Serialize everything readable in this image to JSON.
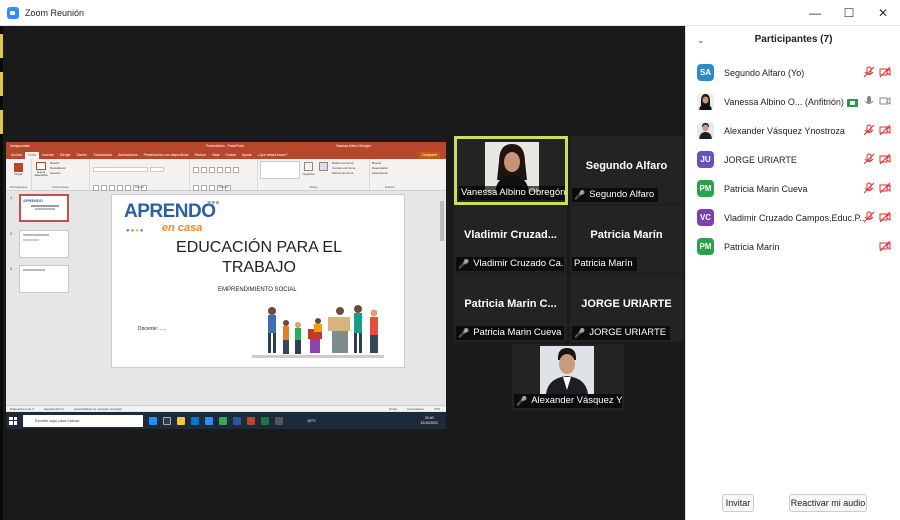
{
  "window": {
    "title": "Zoom Reunión",
    "minimize": "—",
    "maximize": "☐",
    "close": "✕"
  },
  "powerpoint": {
    "title_left": "Autoguardado",
    "title_center": "Presentación - PowerPoint",
    "title_user": "Vanessa Albino Obregón",
    "tabs": [
      "Archivo",
      "Inicio",
      "Insertar",
      "Dibujar",
      "Diseño",
      "Transiciones",
      "Animaciones",
      "Presentación con diapositivas",
      "Revisar",
      "Vista",
      "Grabar",
      "Ayuda",
      "¿Qué desea hacer?"
    ],
    "active_tab": "Inicio",
    "share_button": "Compartir",
    "ribbon_groups": {
      "clipboard": "Portapapeles",
      "slides": "Diapositivas",
      "font": "Fuente",
      "paragraph": "Párrafo",
      "drawing": "Dibujo",
      "editing": "Edición",
      "paste": "Pegar",
      "new_slide": "Nueva diapositiva",
      "design": "Diseño",
      "reset": "Restablecer",
      "section": "Sección",
      "arrange": "Organizar",
      "quick_styles": "Estilos rápidos",
      "shape_fill": "Relleno de forma",
      "shape_outline": "Contorno de forma",
      "shape_effects": "Efectos de forma",
      "find": "Buscar",
      "replace": "Reemplazar",
      "select": "Seleccionar"
    },
    "slide": {
      "logo_top": "APRENDO",
      "logo_bottom": "en casa",
      "title_line1": "EDUCACIÓN PARA EL",
      "title_line2": "TRABAJO",
      "subtitle": "EMPRENDIMIENTO SOCIAL",
      "teacher": "Docente: ....."
    },
    "thumb_numbers": [
      "1",
      "2",
      "3"
    ],
    "status": {
      "slide_count": "Diapositiva 1 de 3",
      "language": "Español (Perú)",
      "accessibility": "Accesibilidad: se necesita investigar",
      "notes": "Notas",
      "comments": "Comentarios",
      "zoom": "72%"
    },
    "taskbar": {
      "search": "Escribe aquí para buscar",
      "temp": "16°C",
      "time": "20:40",
      "date": "12/10/2021"
    }
  },
  "tiles": [
    {
      "name": "",
      "label": "Vanessa Albino Obregón",
      "muted": false,
      "video": true,
      "active": true
    },
    {
      "name": "Segundo Alfaro",
      "label": "Segundo Alfaro",
      "muted": true
    },
    {
      "name": "Vladimir  Cruzad...",
      "label": "Vladimir Cruzado Ca...",
      "muted": true
    },
    {
      "name": "Patricia Marín",
      "label": "Patricia Marín",
      "muted": false
    },
    {
      "name": "Patricia  Marin  C...",
      "label": "Patricia Marin Cueva",
      "muted": true
    },
    {
      "name": "JORGE URIARTE",
      "label": "JORGE URIARTE",
      "muted": true
    },
    {
      "name": "",
      "label": "Alexander Vásquez Y...",
      "muted": true,
      "video": true
    }
  ],
  "participants_panel": {
    "title": "Participantes (7)",
    "invite": "Invitar",
    "unmute": "Reactivar mi audio",
    "items": [
      {
        "initials": "SA",
        "color": "#2d8cc7",
        "name": "Segundo Alfaro (Yo)",
        "mic_muted": true,
        "cam_off": true
      },
      {
        "initials": "",
        "photo": true,
        "name": "Vanessa Albino O...  (Anfitrión)",
        "host": true,
        "mic_muted": false,
        "cam_off": false
      },
      {
        "initials": "",
        "photo": true,
        "name": "Alexander Vásquez Ynostroza",
        "mic_muted": true,
        "cam_off": true
      },
      {
        "initials": "JU",
        "color": "#6a4fbf",
        "name": "JORGE URIARTE",
        "mic_muted": true,
        "cam_off": true
      },
      {
        "initials": "PM",
        "color": "#27a44a",
        "name": "Patricia Marin Cueva",
        "mic_muted": true,
        "cam_off": true
      },
      {
        "initials": "VC",
        "color": "#7b3fb3",
        "name": "Vladimir Cruzado Campos,Educ.P...",
        "mic_muted": true,
        "cam_off": true
      },
      {
        "initials": "PM",
        "color": "#27a44a",
        "name": "Patricia Marín",
        "mic_muted": null,
        "cam_off": true
      }
    ]
  }
}
